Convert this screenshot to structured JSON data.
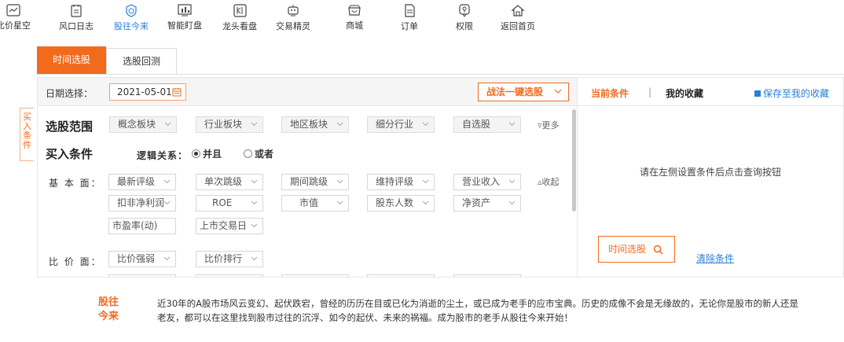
{
  "nav": {
    "items": [
      {
        "label": "比价星空",
        "icon": "chart-window-icon"
      },
      {
        "label": "风口日志",
        "icon": "notebook-icon"
      },
      {
        "label": "股往今来",
        "icon": "shield-clock-icon"
      },
      {
        "label": "智能盯盘",
        "icon": "bar-chart-icon"
      },
      {
        "label": "龙头看盘",
        "icon": "dragon-head-icon"
      },
      {
        "label": "交易精灵",
        "icon": "robot-icon"
      },
      {
        "label": "商城",
        "icon": "shop-icon"
      },
      {
        "label": "订单",
        "icon": "order-icon"
      },
      {
        "label": "权限",
        "icon": "permission-icon"
      },
      {
        "label": "返回首页",
        "icon": "home-icon"
      }
    ],
    "active_index": 2,
    "active_color": "#2a7fd4"
  },
  "tabs": {
    "time_select": "时间选股",
    "backtest": "选股回测"
  },
  "datebar": {
    "label": "日期选择：",
    "date_value": "2021-05-01",
    "quick_select": "战法一键选股"
  },
  "side_tab": {
    "chars": [
      "买",
      "入",
      "条",
      "件"
    ]
  },
  "scope": {
    "title": "选股范围",
    "dropdowns": [
      "概念板块",
      "行业板块",
      "地区板块",
      "细分行业",
      "自选股"
    ],
    "more": "更多"
  },
  "buy": {
    "title": "买入条件",
    "logic_label": "逻辑关系：",
    "options": [
      "并且",
      "或者"
    ],
    "selected": 0
  },
  "fundamentals": {
    "label": "基 本 面：",
    "row1": [
      "最新评级",
      "单次跳级",
      "期间跳级",
      "维持评级",
      "营业收入"
    ],
    "row2": [
      "扣非净利润",
      "ROE",
      "市值",
      "股东人数",
      "净资产"
    ],
    "row3": [
      "市盈率(动)",
      "上市交易日"
    ],
    "collapse": "收起"
  },
  "compare": {
    "label": "比 价 面：",
    "row1": [
      "比价强弱",
      "比价排行"
    ]
  },
  "right_panel": {
    "current_tab": "当前条件",
    "separator": "|",
    "favorites_tab": "我的收藏",
    "save": "保存至我的收藏",
    "hint": "请在左侧设置条件后点击查询按钮",
    "search_button": "时间选股",
    "clear": "清除条件"
  },
  "intro": {
    "title_line1": "股往",
    "title_line2": "今来",
    "text": "近30年的A股市场风云变幻、起伏跌宕，曾经的历历在目或已化为消逝的尘土，或已成为老手的应市宝典。历史的成像不会是无缘故的，无论你是股市的新人还是老友，都可以在这里找到股市过往的沉浮、如今的起伏、未来的祸福。成为股市的老手从股往今来开始！"
  },
  "colors": {
    "accent": "#f26b1d",
    "link": "#2a7fd4"
  }
}
